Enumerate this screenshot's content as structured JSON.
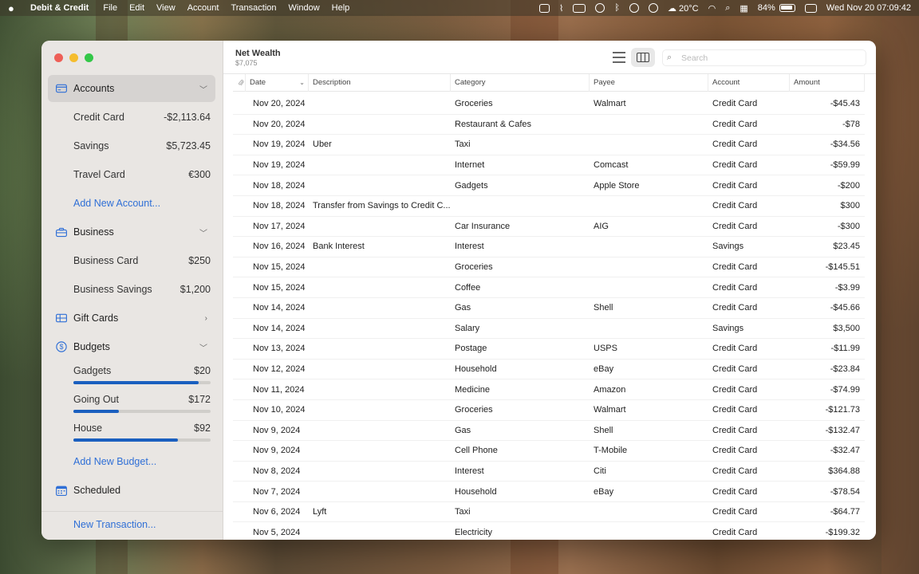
{
  "menubar": {
    "app_name": "Debit & Credit",
    "items": [
      "File",
      "Edit",
      "View",
      "Account",
      "Transaction",
      "Window",
      "Help"
    ],
    "weather": "20°C",
    "battery": "84%",
    "clock": "Wed Nov 20  07:09:42"
  },
  "sidebar": {
    "accounts_label": "Accounts",
    "accounts": [
      {
        "name": "Credit Card",
        "value": "-$2,113.64"
      },
      {
        "name": "Savings",
        "value": "$5,723.45"
      },
      {
        "name": "Travel Card",
        "value": "€300"
      }
    ],
    "add_account": "Add New Account...",
    "business_label": "Business",
    "business": [
      {
        "name": "Business Card",
        "value": "$250"
      },
      {
        "name": "Business Savings",
        "value": "$1,200"
      }
    ],
    "gift_cards_label": "Gift Cards",
    "budgets_label": "Budgets",
    "budgets": [
      {
        "name": "Gadgets",
        "value": "$20",
        "progress": 0.91
      },
      {
        "name": "Going Out",
        "value": "$172",
        "progress": 0.33
      },
      {
        "name": "House",
        "value": "$92",
        "progress": 0.76
      }
    ],
    "add_budget": "Add New Budget...",
    "scheduled_label": "Scheduled",
    "new_transaction": "New Transaction..."
  },
  "toolbar": {
    "title": "Net Wealth",
    "subtitle": "$7,075",
    "search_placeholder": "Search"
  },
  "table": {
    "headers": {
      "date": "Date",
      "description": "Description",
      "category": "Category",
      "payee": "Payee",
      "account": "Account",
      "amount": "Amount"
    },
    "rows": [
      {
        "date": "Nov 20, 2024",
        "description": "",
        "category": "Groceries",
        "payee": "Walmart",
        "account": "Credit Card",
        "amount": "-$45.43"
      },
      {
        "date": "Nov 20, 2024",
        "description": "",
        "category": "Restaurant & Cafes",
        "payee": "",
        "account": "Credit Card",
        "amount": "-$78"
      },
      {
        "date": "Nov 19, 2024",
        "description": "Uber",
        "category": "Taxi",
        "payee": "",
        "account": "Credit Card",
        "amount": "-$34.56"
      },
      {
        "date": "Nov 19, 2024",
        "description": "",
        "category": "Internet",
        "payee": "Comcast",
        "account": "Credit Card",
        "amount": "-$59.99"
      },
      {
        "date": "Nov 18, 2024",
        "description": "",
        "category": "Gadgets",
        "payee": "Apple Store",
        "account": "Credit Card",
        "amount": "-$200"
      },
      {
        "date": "Nov 18, 2024",
        "description": "Transfer from Savings to Credit C...",
        "category": "",
        "payee": "",
        "account": "Credit Card",
        "amount": "$300"
      },
      {
        "date": "Nov 17, 2024",
        "description": "",
        "category": "Car Insurance",
        "payee": "AIG",
        "account": "Credit Card",
        "amount": "-$300"
      },
      {
        "date": "Nov 16, 2024",
        "description": "Bank Interest",
        "category": "Interest",
        "payee": "",
        "account": "Savings",
        "amount": "$23.45"
      },
      {
        "date": "Nov 15, 2024",
        "description": "",
        "category": "Groceries",
        "payee": "",
        "account": "Credit Card",
        "amount": "-$145.51"
      },
      {
        "date": "Nov 15, 2024",
        "description": "",
        "category": "Coffee",
        "payee": "",
        "account": "Credit Card",
        "amount": "-$3.99"
      },
      {
        "date": "Nov 14, 2024",
        "description": "",
        "category": "Gas",
        "payee": "Shell",
        "account": "Credit Card",
        "amount": "-$45.66"
      },
      {
        "date": "Nov 14, 2024",
        "description": "",
        "category": "Salary",
        "payee": "",
        "account": "Savings",
        "amount": "$3,500"
      },
      {
        "date": "Nov 13, 2024",
        "description": "",
        "category": "Postage",
        "payee": "USPS",
        "account": "Credit Card",
        "amount": "-$11.99"
      },
      {
        "date": "Nov 12, 2024",
        "description": "",
        "category": "Household",
        "payee": "eBay",
        "account": "Credit Card",
        "amount": "-$23.84"
      },
      {
        "date": "Nov 11, 2024",
        "description": "",
        "category": "Medicine",
        "payee": "Amazon",
        "account": "Credit Card",
        "amount": "-$74.99"
      },
      {
        "date": "Nov 10, 2024",
        "description": "",
        "category": "Groceries",
        "payee": "Walmart",
        "account": "Credit Card",
        "amount": "-$121.73"
      },
      {
        "date": "Nov 9, 2024",
        "description": "",
        "category": "Gas",
        "payee": "Shell",
        "account": "Credit Card",
        "amount": "-$132.47"
      },
      {
        "date": "Nov 9, 2024",
        "description": "",
        "category": "Cell Phone",
        "payee": "T-Mobile",
        "account": "Credit Card",
        "amount": "-$32.47"
      },
      {
        "date": "Nov 8, 2024",
        "description": "",
        "category": "Interest",
        "payee": "Citi",
        "account": "Credit Card",
        "amount": "$364.88"
      },
      {
        "date": "Nov 7, 2024",
        "description": "",
        "category": "Household",
        "payee": "eBay",
        "account": "Credit Card",
        "amount": "-$78.54"
      },
      {
        "date": "Nov 6, 2024",
        "description": "Lyft",
        "category": "Taxi",
        "payee": "",
        "account": "Credit Card",
        "amount": "-$64.77"
      },
      {
        "date": "Nov 5, 2024",
        "description": "",
        "category": "Electricity",
        "payee": "",
        "account": "Credit Card",
        "amount": "-$199.32"
      }
    ]
  },
  "colors": {
    "accent": "#2f6fd6",
    "budget_fill": "#1a5fbf"
  }
}
